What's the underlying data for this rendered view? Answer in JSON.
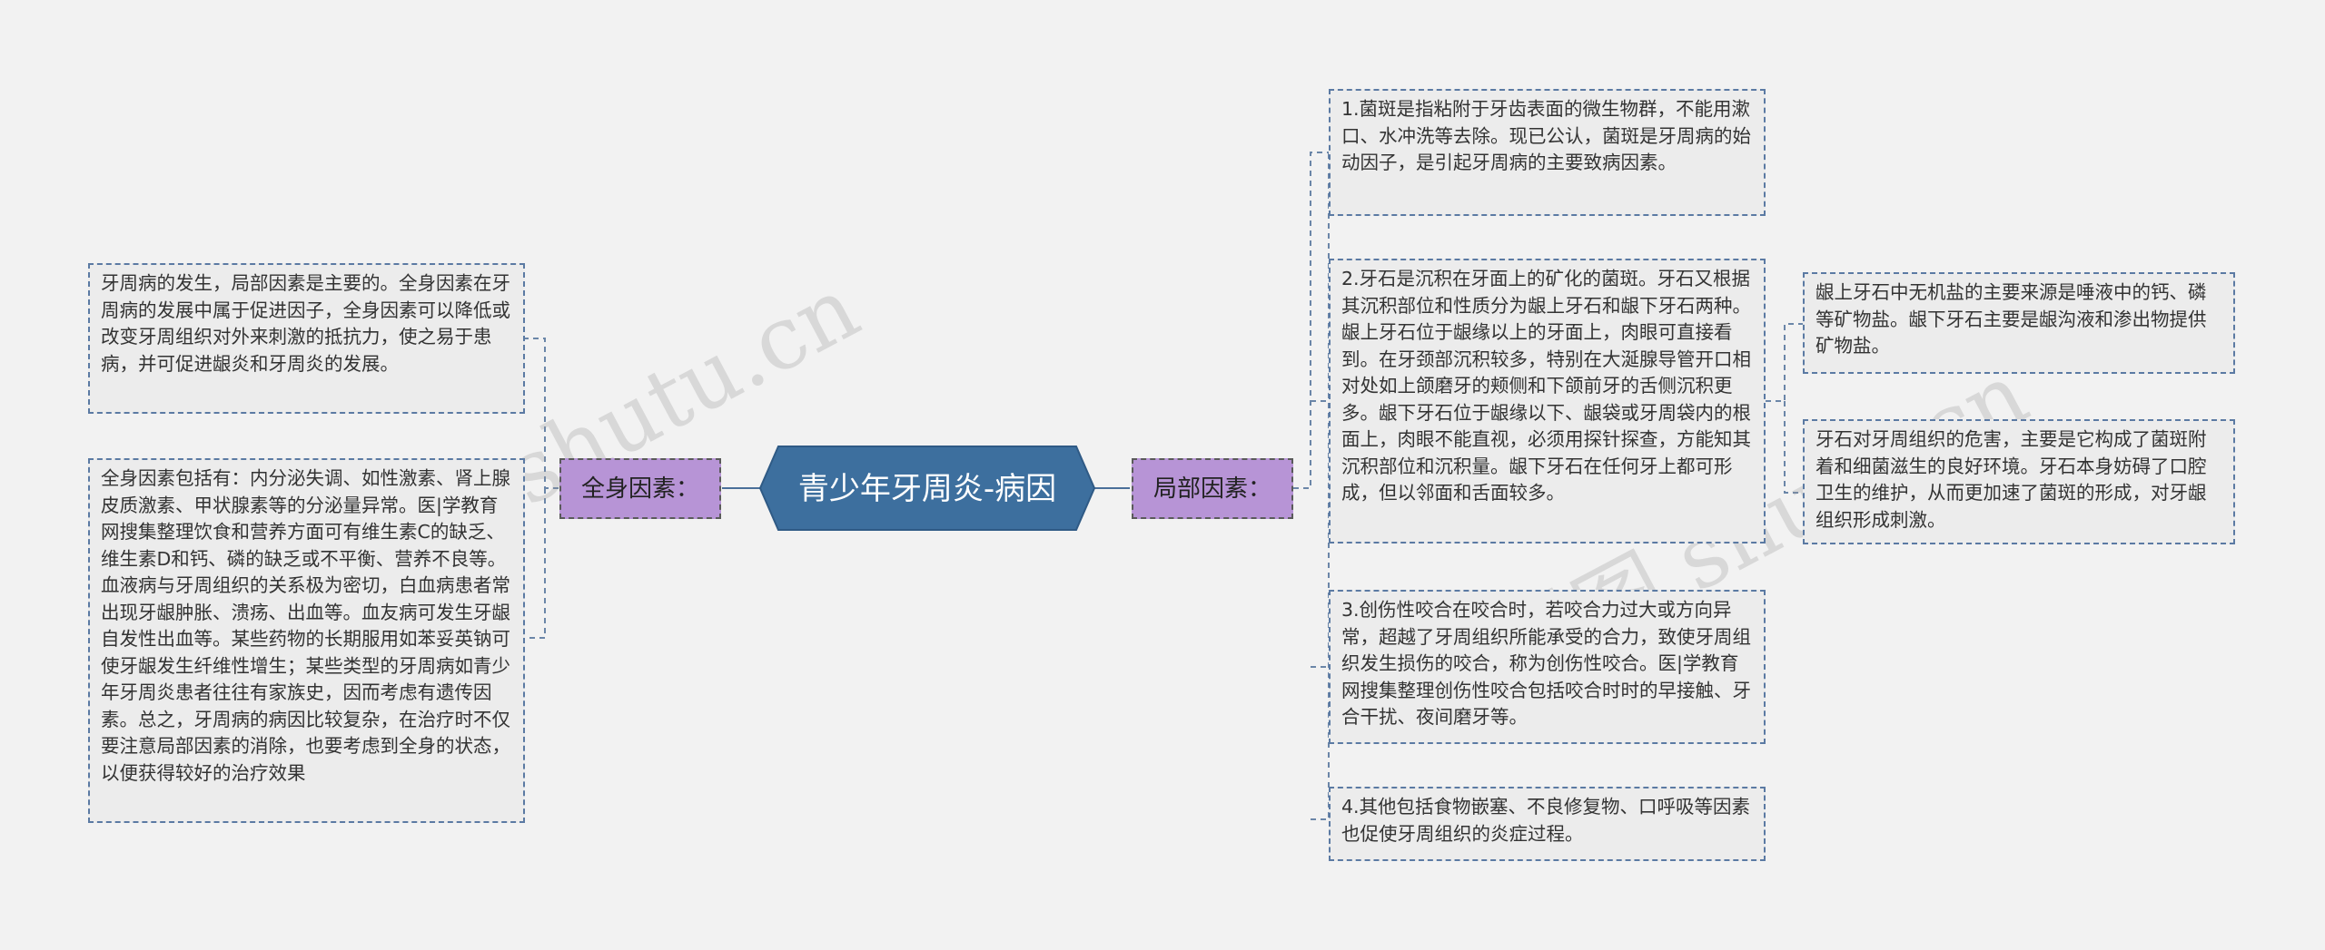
{
  "root": {
    "label": "青少年牙周炎-病因"
  },
  "left": {
    "category": "全身因素：",
    "items": [
      "牙周病的发生，局部因素是主要的。全身因素在牙周病的发展中属于促进因子，全身因素可以降低或改变牙周组织对外来刺激的抵抗力，使之易于患病，并可促进龈炎和牙周炎的发展。",
      "全身因素包括有：内分泌失调、如性激素、肾上腺皮质激素、甲状腺素等的分泌量异常。医|学教育网搜集整理饮食和营养方面可有维生素C的缺乏、维生素D和钙、磷的缺乏或不平衡、营养不良等。血液病与牙周组织的关系极为密切，白血病患者常出现牙龈肿胀、溃疡、出血等。血友病可发生牙龈自发性出血等。某些药物的长期服用如苯妥英钠可使牙龈发生纤维性增生；某些类型的牙周病如青少年牙周炎患者往往有家族史，因而考虑有遗传因素。总之，牙周病的病因比较复杂，在治疗时不仅要注意局部因素的消除，也要考虑到全身的状态，以便获得较好的治疗效果"
    ]
  },
  "right": {
    "category": "局部因素：",
    "items": [
      "1.菌斑是指粘附于牙齿表面的微生物群，不能用漱口、水冲洗等去除。现已公认，菌斑是牙周病的始动因子，是引起牙周病的主要致病因素。",
      "2.牙石是沉积在牙面上的矿化的菌斑。牙石又根据其沉积部位和性质分为龈上牙石和龈下牙石两种。龈上牙石位于龈缘以上的牙面上，肉眼可直接看到。在牙颈部沉积较多，特别在大涎腺导管开口相对处如上颌磨牙的颊侧和下颌前牙的舌侧沉积更多。龈下牙石位于龈缘以下、龈袋或牙周袋内的根面上，肉眼不能直视，必须用探针探查，方能知其沉积部位和沉积量。龈下牙石在任何牙上都可形成，但以邻面和舌面较多。",
      "3.创伤性咬合在咬合时，若咬合力过大或方向异常，超越了牙周组织所能承受的合力，致使牙周组织发生损伤的咬合，称为创伤性咬合。医|学教育网搜集整理创伤性咬合包括咬合时时的早接触、牙合干扰、夜间磨牙等。",
      "4.其他包括食物嵌塞、不良修复物、口呼吸等因素也促使牙周组织的炎症过程。"
    ],
    "sub_items": [
      "龈上牙石中无机盐的主要来源是唾液中的钙、磷等矿物盐。龈下牙石主要是龈沟液和渗出物提供矿物盐。",
      "牙石对牙周组织的危害，主要是它构成了菌斑附着和细菌滋生的良好环境。牙石本身妨碍了口腔卫生的维护，从而更加速了菌斑的形成，对牙龈组织形成刺激。"
    ]
  },
  "watermarks": [
    "shutu.cn",
    "树图 shutu.cn"
  ],
  "colors": {
    "root_fill": "#3d6f9e",
    "category_fill": "#b794d6",
    "leaf_fill": "#ececec",
    "leaf_border": "#5b7aa3",
    "connector": "#4a6f99"
  }
}
